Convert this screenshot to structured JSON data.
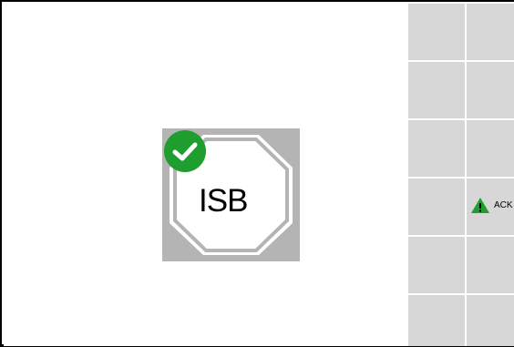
{
  "main": {
    "isb_tile": {
      "label": "ISB",
      "status_icon": "check-circle-icon",
      "colors": {
        "tile_background": "#b4b4b4",
        "octagon_fill": "#ffffff",
        "check_badge": "#1f9e2f"
      }
    }
  },
  "softkey_panel": {
    "rows": [
      {
        "left_label": "",
        "right_label": ""
      },
      {
        "left_label": "",
        "right_label": ""
      },
      {
        "left_label": "",
        "right_label": ""
      },
      {
        "left_label": "",
        "right_label": "ACK",
        "right_icon": "warning-triangle-icon"
      },
      {
        "left_label": "",
        "right_label": ""
      },
      {
        "left_label": "",
        "right_label": ""
      }
    ],
    "colors": {
      "button_fill": "#d7d7d7",
      "warning_triangle": "#1f9e2f"
    }
  }
}
